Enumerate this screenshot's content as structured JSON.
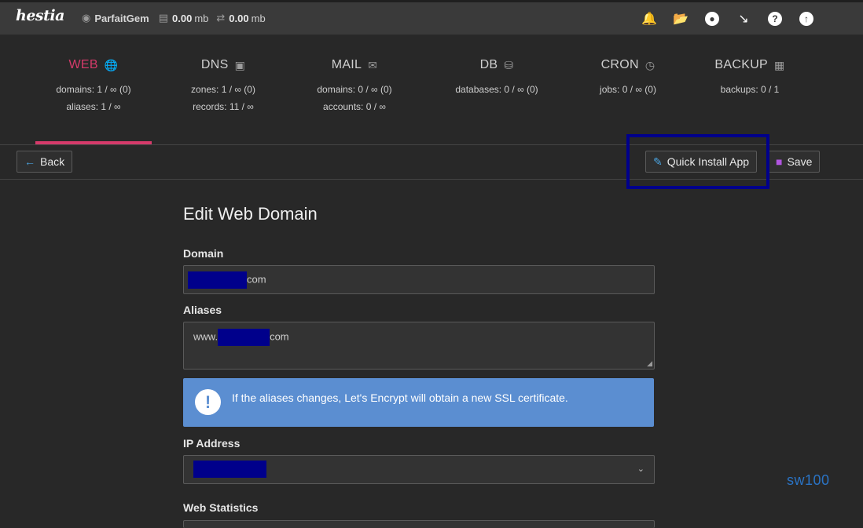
{
  "topbar": {
    "logo": "hestia",
    "username": "ParfaitGem",
    "disk_value": "0.00",
    "disk_unit": "mb",
    "bandwidth_value": "0.00",
    "bandwidth_unit": "mb",
    "icons": [
      "bell-icon",
      "folder-icon",
      "user-icon",
      "chart-icon",
      "help-icon",
      "upload-icon"
    ]
  },
  "tabs": [
    {
      "label": "WEB",
      "icon": "globe-icon",
      "stats": [
        "domains: 1 / ∞ (0)",
        "aliases: 1 / ∞"
      ]
    },
    {
      "label": "DNS",
      "icon": "server-icon",
      "stats": [
        "zones: 1 / ∞ (0)",
        "records: 11 / ∞"
      ]
    },
    {
      "label": "MAIL",
      "icon": "mail-icon",
      "stats": [
        "domains: 0 / ∞ (0)",
        "accounts: 0 / ∞"
      ]
    },
    {
      "label": "DB",
      "icon": "database-icon",
      "stats": [
        "databases: 0 / ∞ (0)"
      ]
    },
    {
      "label": "CRON",
      "icon": "clock-icon",
      "stats": [
        "jobs: 0 / ∞ (0)"
      ]
    },
    {
      "label": "BACKUP",
      "icon": "file-icon",
      "stats": [
        "backups: 0 / 1"
      ]
    }
  ],
  "toolbar": {
    "back_label": "Back",
    "quick_install_label": "Quick Install App",
    "save_label": "Save"
  },
  "form": {
    "title": "Edit Web Domain",
    "domain_label": "Domain",
    "domain_suffix": "com",
    "aliases_label": "Aliases",
    "aliases_prefix": "www.",
    "aliases_suffix": "com",
    "notice_text": "If the aliases changes, Let's Encrypt will obtain a new SSL certificate.",
    "ip_label": "IP Address",
    "web_stats_label": "Web Statistics"
  },
  "watermark": "sw100",
  "colors": {
    "accent": "#d63a6a",
    "notice_bg": "#5b8ed1",
    "highlight_border": "#00008b",
    "redaction": "#00008b"
  }
}
